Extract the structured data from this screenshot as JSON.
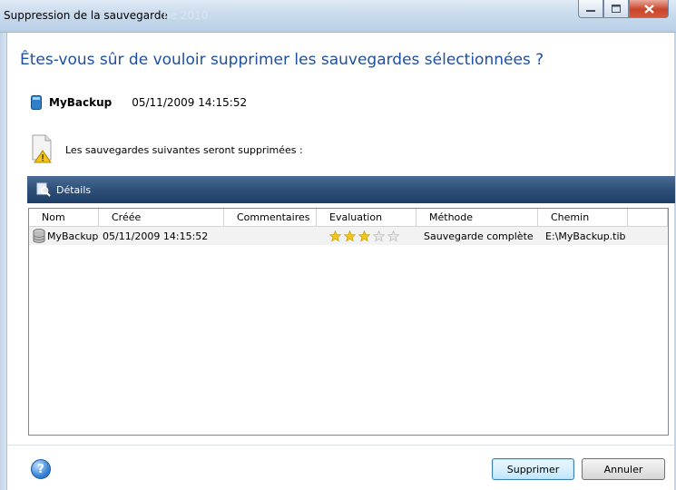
{
  "window": {
    "title": "Suppression de la sauvegarde",
    "title_ghost": "ne 2010",
    "minimize_icon": "minimize-icon",
    "maximize_icon": "maximize-icon",
    "close_icon": "close-icon"
  },
  "dialog": {
    "question": "Êtes-vous sûr de vouloir supprimer les sauvegardes sélectionnées ?",
    "backup_name": "MyBackup",
    "backup_date": "05/11/2009 14:15:52",
    "warning_text": "Les sauvegardes suivantes seront supprimées :",
    "details_label": "Détails"
  },
  "table": {
    "columns": [
      "Nom",
      "Créée",
      "Commentaires",
      "Evaluation",
      "Méthode",
      "Chemin"
    ],
    "rows": [
      {
        "nom": "MyBackup",
        "creee": "05/11/2009 14:15:52",
        "commentaires": "",
        "evaluation": 3,
        "evaluation_max": 5,
        "methode": "Sauvegarde complète",
        "chemin": "E:\\MyBackup.tib"
      }
    ]
  },
  "footer": {
    "help_icon": "help-icon",
    "delete_button": "Supprimer",
    "cancel_button": "Annuler"
  },
  "colors": {
    "heading": "#1e4fa1",
    "details_bar": "#2e4f78",
    "star_filled": "#f5c518",
    "star_empty": "#e8e8e8"
  }
}
